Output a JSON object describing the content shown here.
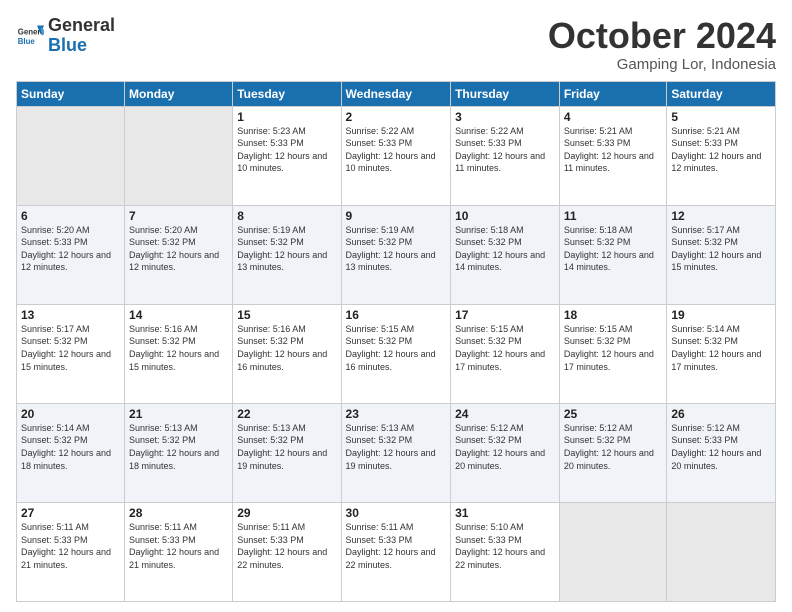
{
  "logo": {
    "line1": "General",
    "line2": "Blue"
  },
  "header": {
    "month": "October 2024",
    "location": "Gamping Lor, Indonesia"
  },
  "weekdays": [
    "Sunday",
    "Monday",
    "Tuesday",
    "Wednesday",
    "Thursday",
    "Friday",
    "Saturday"
  ],
  "weeks": [
    [
      {
        "day": "",
        "sunrise": "",
        "sunset": "",
        "daylight": ""
      },
      {
        "day": "",
        "sunrise": "",
        "sunset": "",
        "daylight": ""
      },
      {
        "day": "1",
        "sunrise": "Sunrise: 5:23 AM",
        "sunset": "Sunset: 5:33 PM",
        "daylight": "Daylight: 12 hours and 10 minutes."
      },
      {
        "day": "2",
        "sunrise": "Sunrise: 5:22 AM",
        "sunset": "Sunset: 5:33 PM",
        "daylight": "Daylight: 12 hours and 10 minutes."
      },
      {
        "day": "3",
        "sunrise": "Sunrise: 5:22 AM",
        "sunset": "Sunset: 5:33 PM",
        "daylight": "Daylight: 12 hours and 11 minutes."
      },
      {
        "day": "4",
        "sunrise": "Sunrise: 5:21 AM",
        "sunset": "Sunset: 5:33 PM",
        "daylight": "Daylight: 12 hours and 11 minutes."
      },
      {
        "day": "5",
        "sunrise": "Sunrise: 5:21 AM",
        "sunset": "Sunset: 5:33 PM",
        "daylight": "Daylight: 12 hours and 12 minutes."
      }
    ],
    [
      {
        "day": "6",
        "sunrise": "Sunrise: 5:20 AM",
        "sunset": "Sunset: 5:33 PM",
        "daylight": "Daylight: 12 hours and 12 minutes."
      },
      {
        "day": "7",
        "sunrise": "Sunrise: 5:20 AM",
        "sunset": "Sunset: 5:32 PM",
        "daylight": "Daylight: 12 hours and 12 minutes."
      },
      {
        "day": "8",
        "sunrise": "Sunrise: 5:19 AM",
        "sunset": "Sunset: 5:32 PM",
        "daylight": "Daylight: 12 hours and 13 minutes."
      },
      {
        "day": "9",
        "sunrise": "Sunrise: 5:19 AM",
        "sunset": "Sunset: 5:32 PM",
        "daylight": "Daylight: 12 hours and 13 minutes."
      },
      {
        "day": "10",
        "sunrise": "Sunrise: 5:18 AM",
        "sunset": "Sunset: 5:32 PM",
        "daylight": "Daylight: 12 hours and 14 minutes."
      },
      {
        "day": "11",
        "sunrise": "Sunrise: 5:18 AM",
        "sunset": "Sunset: 5:32 PM",
        "daylight": "Daylight: 12 hours and 14 minutes."
      },
      {
        "day": "12",
        "sunrise": "Sunrise: 5:17 AM",
        "sunset": "Sunset: 5:32 PM",
        "daylight": "Daylight: 12 hours and 15 minutes."
      }
    ],
    [
      {
        "day": "13",
        "sunrise": "Sunrise: 5:17 AM",
        "sunset": "Sunset: 5:32 PM",
        "daylight": "Daylight: 12 hours and 15 minutes."
      },
      {
        "day": "14",
        "sunrise": "Sunrise: 5:16 AM",
        "sunset": "Sunset: 5:32 PM",
        "daylight": "Daylight: 12 hours and 15 minutes."
      },
      {
        "day": "15",
        "sunrise": "Sunrise: 5:16 AM",
        "sunset": "Sunset: 5:32 PM",
        "daylight": "Daylight: 12 hours and 16 minutes."
      },
      {
        "day": "16",
        "sunrise": "Sunrise: 5:15 AM",
        "sunset": "Sunset: 5:32 PM",
        "daylight": "Daylight: 12 hours and 16 minutes."
      },
      {
        "day": "17",
        "sunrise": "Sunrise: 5:15 AM",
        "sunset": "Sunset: 5:32 PM",
        "daylight": "Daylight: 12 hours and 17 minutes."
      },
      {
        "day": "18",
        "sunrise": "Sunrise: 5:15 AM",
        "sunset": "Sunset: 5:32 PM",
        "daylight": "Daylight: 12 hours and 17 minutes."
      },
      {
        "day": "19",
        "sunrise": "Sunrise: 5:14 AM",
        "sunset": "Sunset: 5:32 PM",
        "daylight": "Daylight: 12 hours and 17 minutes."
      }
    ],
    [
      {
        "day": "20",
        "sunrise": "Sunrise: 5:14 AM",
        "sunset": "Sunset: 5:32 PM",
        "daylight": "Daylight: 12 hours and 18 minutes."
      },
      {
        "day": "21",
        "sunrise": "Sunrise: 5:13 AM",
        "sunset": "Sunset: 5:32 PM",
        "daylight": "Daylight: 12 hours and 18 minutes."
      },
      {
        "day": "22",
        "sunrise": "Sunrise: 5:13 AM",
        "sunset": "Sunset: 5:32 PM",
        "daylight": "Daylight: 12 hours and 19 minutes."
      },
      {
        "day": "23",
        "sunrise": "Sunrise: 5:13 AM",
        "sunset": "Sunset: 5:32 PM",
        "daylight": "Daylight: 12 hours and 19 minutes."
      },
      {
        "day": "24",
        "sunrise": "Sunrise: 5:12 AM",
        "sunset": "Sunset: 5:32 PM",
        "daylight": "Daylight: 12 hours and 20 minutes."
      },
      {
        "day": "25",
        "sunrise": "Sunrise: 5:12 AM",
        "sunset": "Sunset: 5:32 PM",
        "daylight": "Daylight: 12 hours and 20 minutes."
      },
      {
        "day": "26",
        "sunrise": "Sunrise: 5:12 AM",
        "sunset": "Sunset: 5:33 PM",
        "daylight": "Daylight: 12 hours and 20 minutes."
      }
    ],
    [
      {
        "day": "27",
        "sunrise": "Sunrise: 5:11 AM",
        "sunset": "Sunset: 5:33 PM",
        "daylight": "Daylight: 12 hours and 21 minutes."
      },
      {
        "day": "28",
        "sunrise": "Sunrise: 5:11 AM",
        "sunset": "Sunset: 5:33 PM",
        "daylight": "Daylight: 12 hours and 21 minutes."
      },
      {
        "day": "29",
        "sunrise": "Sunrise: 5:11 AM",
        "sunset": "Sunset: 5:33 PM",
        "daylight": "Daylight: 12 hours and 22 minutes."
      },
      {
        "day": "30",
        "sunrise": "Sunrise: 5:11 AM",
        "sunset": "Sunset: 5:33 PM",
        "daylight": "Daylight: 12 hours and 22 minutes."
      },
      {
        "day": "31",
        "sunrise": "Sunrise: 5:10 AM",
        "sunset": "Sunset: 5:33 PM",
        "daylight": "Daylight: 12 hours and 22 minutes."
      },
      {
        "day": "",
        "sunrise": "",
        "sunset": "",
        "daylight": ""
      },
      {
        "day": "",
        "sunrise": "",
        "sunset": "",
        "daylight": ""
      }
    ]
  ]
}
